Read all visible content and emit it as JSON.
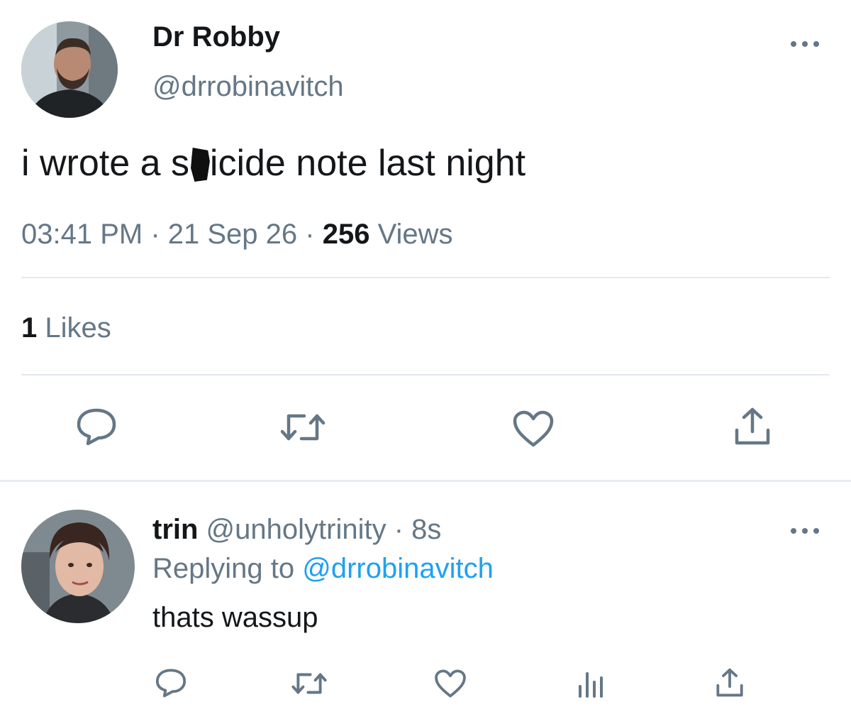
{
  "main_tweet": {
    "display_name": "Dr Robby",
    "handle": "@drrobinavitch",
    "text_before": "i wrote a s",
    "text_after": "icide note last night",
    "time": "03:41 PM",
    "separator": " · ",
    "date": "21 Sep 26",
    "views_count": "256",
    "views_label": " Views",
    "likes_count": "1",
    "likes_label": " Likes"
  },
  "reply": {
    "display_name": "trin",
    "handle": " @unholytrinity",
    "time": " · 8s",
    "replying_prefix": "Replying to ",
    "replying_mention": "@drrobinavitch",
    "text": "thats wassup"
  },
  "icons": {
    "reply": "comment-icon",
    "retweet": "retweet-icon",
    "like": "heart-icon",
    "share": "share-icon",
    "analytics": "analytics-icon",
    "more": "more-icon"
  },
  "colors": {
    "primary_text": "#14171a",
    "secondary_text": "#657786",
    "link": "#1da1f2",
    "divider": "#e1e8ed"
  }
}
